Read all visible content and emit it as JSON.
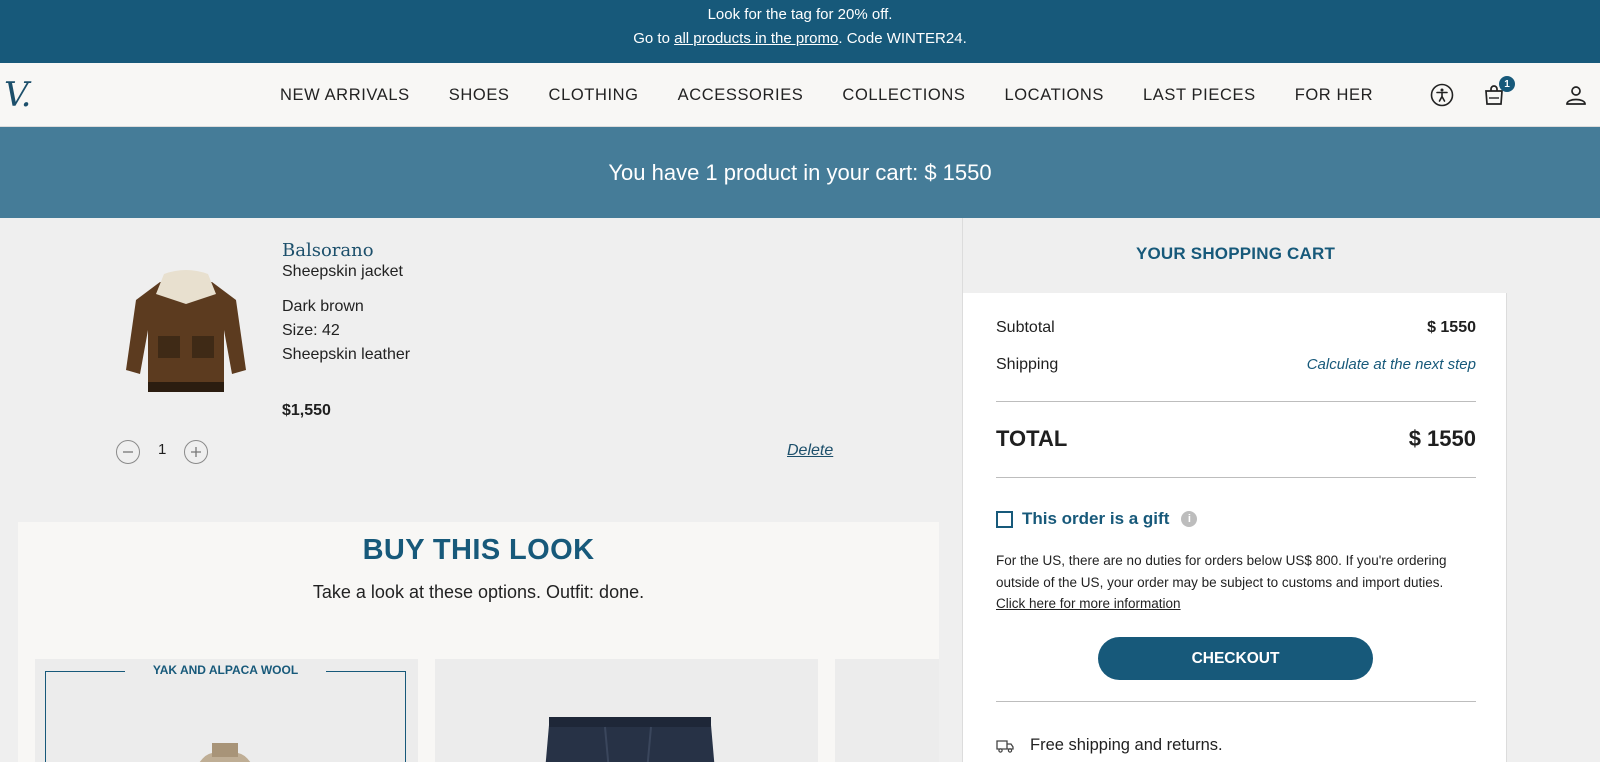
{
  "promo": {
    "line1": "Look for the tag for 20% off.",
    "line2_prefix": "Go to ",
    "line2_link": "all products in the promo",
    "line2_suffix": ". Code WINTER24."
  },
  "nav": {
    "logo": "V.",
    "links": [
      "NEW ARRIVALS",
      "SHOES",
      "CLOTHING",
      "ACCESSORIES",
      "COLLECTIONS",
      "LOCATIONS",
      "LAST PIECES",
      "FOR HER"
    ],
    "cart_count": "1",
    "icons": [
      "accessibility-icon",
      "shopping-bag-icon",
      "user-icon"
    ]
  },
  "cart_banner": "You have 1 product in your cart: $ 1550",
  "item": {
    "brand": "Balsorano",
    "name": "Sheepskin jacket",
    "color": "Dark brown",
    "size": "Size: 42",
    "material": "Sheepskin leather",
    "price": "$1,550",
    "quantity": "1",
    "delete_label": "Delete"
  },
  "look": {
    "title": "BUY THIS LOOK",
    "subtitle": "Take a look at these options. Outfit: done.",
    "card1_tag": "YAK AND ALPACA WOOL"
  },
  "summary": {
    "heading": "YOUR SHOPPING CART",
    "subtotal_label": "Subtotal",
    "subtotal_value": "$ 1550",
    "shipping_label": "Shipping",
    "shipping_value": "Calculate at the next step",
    "total_label": "TOTAL",
    "total_value": "$ 1550",
    "gift_label": "This order is a gift",
    "gift_checked": false,
    "duties_text": "For the US, there are no duties for orders below US$ 800. If you're ordering outside of the US, your order may be subject to customs and import duties.",
    "duties_link": "Click here for more information",
    "checkout_label": "CHECKOUT",
    "free_shipping": "Free shipping and returns."
  },
  "colors": {
    "brand_blue": "#17597a",
    "banner_blue": "#457c98",
    "background": "#efefef"
  }
}
